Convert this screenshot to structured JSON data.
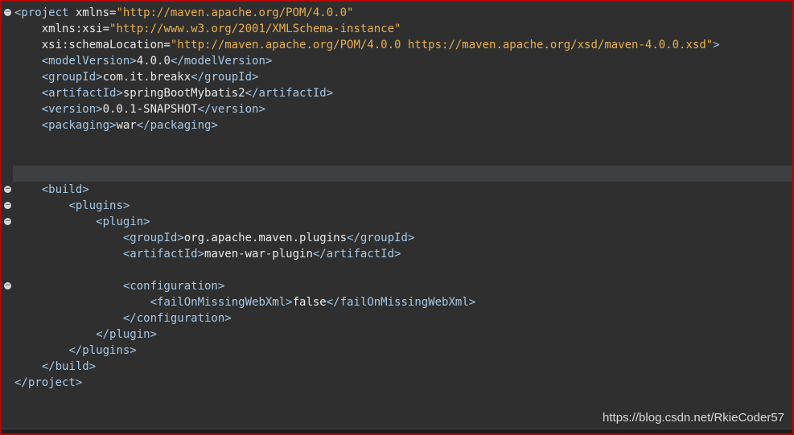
{
  "editor": {
    "lines": [
      {
        "indent": "",
        "open": "<project ",
        "attr": "xmlns=",
        "val": "\"http://maven.apache.org/POM/4.0.0\"",
        "close": "",
        "text": "",
        "end": ""
      },
      {
        "indent": "    ",
        "open": "",
        "attr": "xmlns:xsi=",
        "val": "\"http://www.w3.org/2001/XMLSchema-instance\"",
        "close": "",
        "text": "",
        "end": ""
      },
      {
        "indent": "    ",
        "open": "",
        "attr": "xsi:schemaLocation=",
        "val": "\"http://maven.apache.org/POM/4.0.0 https://maven.apache.org/xsd/maven-4.0.0.xsd\"",
        "close": ">",
        "text": "",
        "end": ""
      },
      {
        "indent": "    ",
        "open": "<modelVersion>",
        "attr": "",
        "val": "",
        "close": "",
        "text": "4.0.0",
        "end": "</modelVersion>"
      },
      {
        "indent": "    ",
        "open": "<groupId>",
        "attr": "",
        "val": "",
        "close": "",
        "text": "com.it.breakx",
        "end": "</groupId>"
      },
      {
        "indent": "    ",
        "open": "<artifactId>",
        "attr": "",
        "val": "",
        "close": "",
        "text": "springBootMybatis2",
        "end": "</artifactId>"
      },
      {
        "indent": "    ",
        "open": "<version>",
        "attr": "",
        "val": "",
        "close": "",
        "text": "0.0.1-SNAPSHOT",
        "end": "</version>"
      },
      {
        "indent": "    ",
        "open": "<packaging>",
        "attr": "",
        "val": "",
        "close": "",
        "text": "war",
        "end": "</packaging>"
      },
      {
        "indent": "",
        "open": "",
        "attr": "",
        "val": "",
        "close": "",
        "text": "",
        "end": ""
      },
      {
        "indent": "",
        "open": "",
        "attr": "",
        "val": "",
        "close": "",
        "text": "",
        "end": ""
      },
      {
        "indent": "",
        "open": "",
        "attr": "",
        "val": "",
        "close": "",
        "text": "",
        "end": ""
      },
      {
        "indent": "    ",
        "open": "<build>",
        "attr": "",
        "val": "",
        "close": "",
        "text": "",
        "end": ""
      },
      {
        "indent": "        ",
        "open": "<plugins>",
        "attr": "",
        "val": "",
        "close": "",
        "text": "",
        "end": ""
      },
      {
        "indent": "            ",
        "open": "<plugin>",
        "attr": "",
        "val": "",
        "close": "",
        "text": "",
        "end": ""
      },
      {
        "indent": "                ",
        "open": "<groupId>",
        "attr": "",
        "val": "",
        "close": "",
        "text": "org.apache.maven.plugins",
        "end": "</groupId>"
      },
      {
        "indent": "                ",
        "open": "<artifactId>",
        "attr": "",
        "val": "",
        "close": "",
        "text": "maven-war-plugin",
        "end": "</artifactId>"
      },
      {
        "indent": "",
        "open": "",
        "attr": "",
        "val": "",
        "close": "",
        "text": "",
        "end": ""
      },
      {
        "indent": "                ",
        "open": "<configuration>",
        "attr": "",
        "val": "",
        "close": "",
        "text": "",
        "end": ""
      },
      {
        "indent": "                    ",
        "open": "<failOnMissingWebXml>",
        "attr": "",
        "val": "",
        "close": "",
        "text": "false",
        "end": "</failOnMissingWebXml>"
      },
      {
        "indent": "                ",
        "open": "</configuration>",
        "attr": "",
        "val": "",
        "close": "",
        "text": "",
        "end": ""
      },
      {
        "indent": "            ",
        "open": "</plugin>",
        "attr": "",
        "val": "",
        "close": "",
        "text": "",
        "end": ""
      },
      {
        "indent": "        ",
        "open": "</plugins>",
        "attr": "",
        "val": "",
        "close": "",
        "text": "",
        "end": ""
      },
      {
        "indent": "    ",
        "open": "</build>",
        "attr": "",
        "val": "",
        "close": "",
        "text": "",
        "end": ""
      },
      {
        "indent": "",
        "open": "</project>",
        "attr": "",
        "val": "",
        "close": "",
        "text": "",
        "end": ""
      }
    ],
    "fold_lines": [
      0,
      11,
      12,
      13,
      17
    ],
    "current_line": 10,
    "fold_glyph": "−"
  },
  "watermark": "https://blog.csdn.net/RkieCoder57",
  "colors": {
    "background": "#2f2f2f",
    "tag": "#a6c8e6",
    "attribute_value": "#e8b04c",
    "text": "#e8e8e8",
    "border": "#c00000"
  }
}
